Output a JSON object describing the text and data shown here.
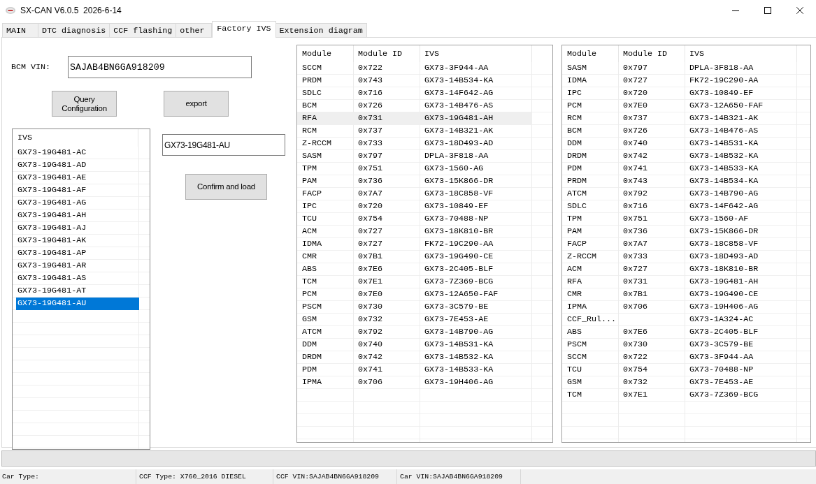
{
  "window": {
    "title": "SX-CAN V6.0.5  2026-6-14"
  },
  "tabs": [
    {
      "label": "MAIN",
      "selected": false
    },
    {
      "label": "DTC diagnosis",
      "selected": false
    },
    {
      "label": "CCF flashing",
      "selected": false
    },
    {
      "label": "other",
      "selected": false
    },
    {
      "label": "Factory IVS",
      "selected": true
    },
    {
      "label": "Extension diagram",
      "selected": false
    }
  ],
  "bcm_vin": {
    "label": "BCM VIN:",
    "value": "SAJAB4BN6GA918209"
  },
  "query_button": {
    "label": "Query Configuration"
  },
  "export_button": {
    "label": "export"
  },
  "ivs_list": {
    "column": "IVS",
    "items": [
      {
        "label": "GX73-19G481-AC",
        "selected": false
      },
      {
        "label": "GX73-19G481-AD",
        "selected": false
      },
      {
        "label": "GX73-19G481-AE",
        "selected": false
      },
      {
        "label": "GX73-19G481-AF",
        "selected": false
      },
      {
        "label": "GX73-19G481-AG",
        "selected": false
      },
      {
        "label": "GX73-19G481-AH",
        "selected": false
      },
      {
        "label": "GX73-19G481-AJ",
        "selected": false
      },
      {
        "label": "GX73-19G481-AK",
        "selected": false
      },
      {
        "label": "GX73-19G481-AP",
        "selected": false
      },
      {
        "label": "GX73-19G481-AR",
        "selected": false
      },
      {
        "label": "GX73-19G481-AS",
        "selected": false
      },
      {
        "label": "GX73-19G481-AT",
        "selected": false
      },
      {
        "label": "GX73-19G481-AU",
        "selected": true
      }
    ]
  },
  "ivs_field": {
    "value": "GX73-19G481-AU"
  },
  "confirm_button": {
    "label": "Confirm and load"
  },
  "module_tables": [
    {
      "columns": [
        "Module",
        "Module ID",
        "IVS"
      ],
      "rows": [
        {
          "module": "SCCM",
          "module_id": "0x722",
          "ivs": "GX73-3F944-AA",
          "selected": false
        },
        {
          "module": "PRDM",
          "module_id": "0x743",
          "ivs": "GX73-14B534-KA",
          "selected": false
        },
        {
          "module": "SDLC",
          "module_id": "0x716",
          "ivs": "GX73-14F642-AG",
          "selected": false
        },
        {
          "module": "BCM",
          "module_id": "0x726",
          "ivs": "GX73-14B476-AS",
          "selected": false
        },
        {
          "module": "RFA",
          "module_id": "0x731",
          "ivs": "GX73-19G481-AH",
          "selected": true
        },
        {
          "module": "RCM",
          "module_id": "0x737",
          "ivs": "GX73-14B321-AK",
          "selected": false
        },
        {
          "module": "Z-RCCM",
          "module_id": "0x733",
          "ivs": "GX73-18D493-AD",
          "selected": false
        },
        {
          "module": "SASM",
          "module_id": "0x797",
          "ivs": "DPLA-3F818-AA",
          "selected": false
        },
        {
          "module": "TPM",
          "module_id": "0x751",
          "ivs": "GX73-1560-AG",
          "selected": false
        },
        {
          "module": "PAM",
          "module_id": "0x736",
          "ivs": "GX73-15K866-DR",
          "selected": false
        },
        {
          "module": "FACP",
          "module_id": "0x7A7",
          "ivs": "GX73-18C858-VF",
          "selected": false
        },
        {
          "module": "IPC",
          "module_id": "0x720",
          "ivs": "GX73-10849-EF",
          "selected": false
        },
        {
          "module": "TCU",
          "module_id": "0x754",
          "ivs": "GX73-70488-NP",
          "selected": false
        },
        {
          "module": "ACM",
          "module_id": "0x727",
          "ivs": "GX73-18K810-BR",
          "selected": false
        },
        {
          "module": "IDMA",
          "module_id": "0x727",
          "ivs": "FK72-19C290-AA",
          "selected": false
        },
        {
          "module": "CMR",
          "module_id": "0x7B1",
          "ivs": "GX73-19G490-CE",
          "selected": false
        },
        {
          "module": "ABS",
          "module_id": "0x7E6",
          "ivs": "GX73-2C405-BLF",
          "selected": false
        },
        {
          "module": "TCM",
          "module_id": "0x7E1",
          "ivs": "GX73-7Z369-BCG",
          "selected": false
        },
        {
          "module": "PCM",
          "module_id": "0x7E0",
          "ivs": "GX73-12A650-FAF",
          "selected": false
        },
        {
          "module": "PSCM",
          "module_id": "0x730",
          "ivs": "GX73-3C579-BE",
          "selected": false
        },
        {
          "module": "GSM",
          "module_id": "0x732",
          "ivs": "GX73-7E453-AE",
          "selected": false
        },
        {
          "module": "ATCM",
          "module_id": "0x792",
          "ivs": "GX73-14B790-AG",
          "selected": false
        },
        {
          "module": "DDM",
          "module_id": "0x740",
          "ivs": "GX73-14B531-KA",
          "selected": false
        },
        {
          "module": "DRDM",
          "module_id": "0x742",
          "ivs": "GX73-14B532-KA",
          "selected": false
        },
        {
          "module": "PDM",
          "module_id": "0x741",
          "ivs": "GX73-14B533-KA",
          "selected": false
        },
        {
          "module": "IPMA",
          "module_id": "0x706",
          "ivs": "GX73-19H406-AG",
          "selected": false
        }
      ]
    },
    {
      "columns": [
        "Module",
        "Module ID",
        "IVS"
      ],
      "rows": [
        {
          "module": "SASM",
          "module_id": "0x797",
          "ivs": "DPLA-3F818-AA",
          "selected": false
        },
        {
          "module": "IDMA",
          "module_id": "0x727",
          "ivs": "FK72-19C290-AA",
          "selected": false
        },
        {
          "module": "IPC",
          "module_id": "0x720",
          "ivs": "GX73-10849-EF",
          "selected": false
        },
        {
          "module": "PCM",
          "module_id": "0x7E0",
          "ivs": "GX73-12A650-FAF",
          "selected": false
        },
        {
          "module": "RCM",
          "module_id": "0x737",
          "ivs": "GX73-14B321-AK",
          "selected": false
        },
        {
          "module": "BCM",
          "module_id": "0x726",
          "ivs": "GX73-14B476-AS",
          "selected": false
        },
        {
          "module": "DDM",
          "module_id": "0x740",
          "ivs": "GX73-14B531-KA",
          "selected": false
        },
        {
          "module": "DRDM",
          "module_id": "0x742",
          "ivs": "GX73-14B532-KA",
          "selected": false
        },
        {
          "module": "PDM",
          "module_id": "0x741",
          "ivs": "GX73-14B533-KA",
          "selected": false
        },
        {
          "module": "PRDM",
          "module_id": "0x743",
          "ivs": "GX73-14B534-KA",
          "selected": false
        },
        {
          "module": "ATCM",
          "module_id": "0x792",
          "ivs": "GX73-14B790-AG",
          "selected": false
        },
        {
          "module": "SDLC",
          "module_id": "0x716",
          "ivs": "GX73-14F642-AG",
          "selected": false
        },
        {
          "module": "TPM",
          "module_id": "0x751",
          "ivs": "GX73-1560-AF",
          "selected": false
        },
        {
          "module": "PAM",
          "module_id": "0x736",
          "ivs": "GX73-15K866-DR",
          "selected": false
        },
        {
          "module": "FACP",
          "module_id": "0x7A7",
          "ivs": "GX73-18C858-VF",
          "selected": false
        },
        {
          "module": "Z-RCCM",
          "module_id": "0x733",
          "ivs": "GX73-18D493-AD",
          "selected": false
        },
        {
          "module": "ACM",
          "module_id": "0x727",
          "ivs": "GX73-18K810-BR",
          "selected": false
        },
        {
          "module": "RFA",
          "module_id": "0x731",
          "ivs": "GX73-19G481-AH",
          "selected": false
        },
        {
          "module": "CMR",
          "module_id": "0x7B1",
          "ivs": "GX73-19G490-CE",
          "selected": false
        },
        {
          "module": "IPMA",
          "module_id": "0x706",
          "ivs": "GX73-19H406-AG",
          "selected": false
        },
        {
          "module": "CCF_Rul...",
          "ivs": "GX73-1A324-AC",
          "selected": false
        },
        {
          "module": "ABS",
          "module_id": "0x7E6",
          "ivs": "GX73-2C405-BLF",
          "selected": false
        },
        {
          "module": "PSCM",
          "module_id": "0x730",
          "ivs": "GX73-3C579-BE",
          "selected": false
        },
        {
          "module": "SCCM",
          "module_id": "0x722",
          "ivs": "GX73-3F944-AA",
          "selected": false
        },
        {
          "module": "TCU",
          "module_id": "0x754",
          "ivs": "GX73-70488-NP",
          "selected": false
        },
        {
          "module": "GSM",
          "module_id": "0x732",
          "ivs": "GX73-7E453-AE",
          "selected": false
        },
        {
          "module": "TCM",
          "module_id": "0x7E1",
          "ivs": "GX73-7Z369-BCG",
          "selected": false
        }
      ]
    }
  ],
  "progress_bar": {
    "level": 0
  },
  "status_bar": [
    "Car Type:",
    "CCF Type: X760_2016 DIESEL",
    "CCF VIN:SAJAB4BN6GA918209",
    "Car VIN:SAJAB4BN6GA918209"
  ]
}
